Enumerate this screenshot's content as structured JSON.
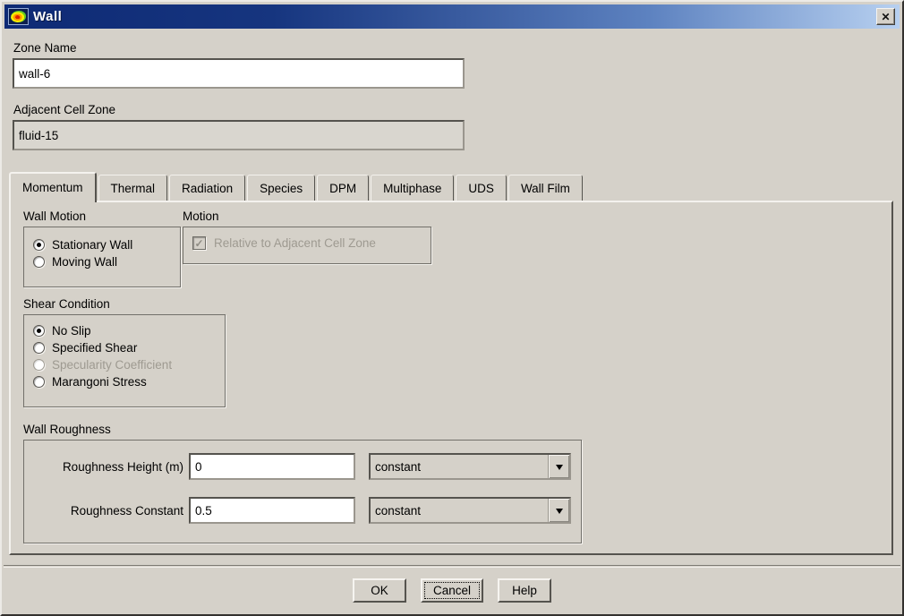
{
  "window": {
    "title": "Wall",
    "close_glyph": "✕"
  },
  "colors": {
    "titlebar_left": "#0e2a75",
    "titlebar_right": "#b7d0f0",
    "dialog_bg": "#d5d1c9",
    "disabled_text": "#9e9a91"
  },
  "zone_name": {
    "label": "Zone Name",
    "value": "wall-6"
  },
  "adjacent_cell_zone": {
    "label": "Adjacent Cell Zone",
    "value": "fluid-15"
  },
  "tabs": [
    {
      "label": "Momentum",
      "active": true
    },
    {
      "label": "Thermal",
      "active": false
    },
    {
      "label": "Radiation",
      "active": false
    },
    {
      "label": "Species",
      "active": false
    },
    {
      "label": "DPM",
      "active": false
    },
    {
      "label": "Multiphase",
      "active": false
    },
    {
      "label": "UDS",
      "active": false
    },
    {
      "label": "Wall Film",
      "active": false
    }
  ],
  "momentum": {
    "wall_motion": {
      "label": "Wall Motion",
      "options": [
        {
          "label": "Stationary Wall",
          "selected": true,
          "disabled": false
        },
        {
          "label": "Moving Wall",
          "selected": false,
          "disabled": false
        }
      ]
    },
    "motion": {
      "label": "Motion",
      "checkbox": {
        "label": "Relative to Adjacent Cell Zone",
        "checked": true,
        "disabled": true,
        "check_glyph": "✓"
      }
    },
    "shear_condition": {
      "label": "Shear Condition",
      "options": [
        {
          "label": "No Slip",
          "selected": true,
          "disabled": false
        },
        {
          "label": "Specified Shear",
          "selected": false,
          "disabled": false
        },
        {
          "label": "Specularity Coefficient",
          "selected": false,
          "disabled": true
        },
        {
          "label": "Marangoni Stress",
          "selected": false,
          "disabled": false
        }
      ]
    },
    "wall_roughness": {
      "label": "Wall Roughness",
      "rows": [
        {
          "label": "Roughness Height (m)",
          "value": "0",
          "profile": "constant"
        },
        {
          "label": "Roughness Constant",
          "value": "0.5",
          "profile": "constant"
        }
      ]
    }
  },
  "buttons": {
    "ok": "OK",
    "cancel": "Cancel",
    "help": "Help"
  }
}
